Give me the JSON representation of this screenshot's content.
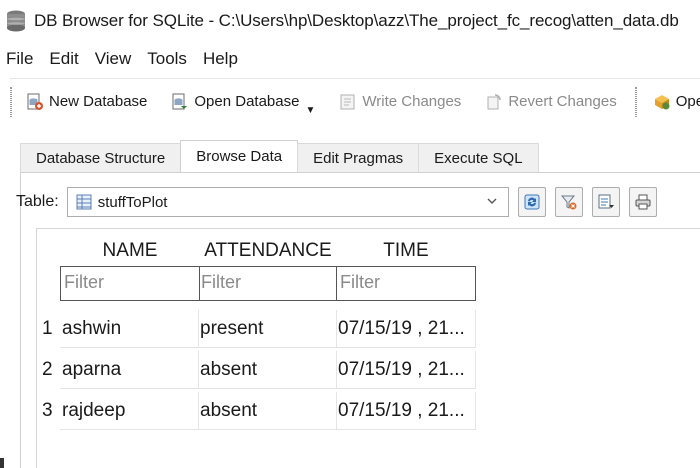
{
  "window": {
    "title": "DB Browser for SQLite - C:\\Users\\hp\\Desktop\\azz\\The_project_fc_recog\\atten_data.db"
  },
  "menu": [
    "File",
    "Edit",
    "View",
    "Tools",
    "Help"
  ],
  "toolbar": {
    "new_database": "New Database",
    "open_database": "Open Database",
    "write_changes": "Write Changes",
    "revert_changes": "Revert Changes",
    "open_project": "Ope"
  },
  "tabs": [
    "Database Structure",
    "Browse Data",
    "Edit Pragmas",
    "Execute SQL"
  ],
  "active_tab": "Browse Data",
  "table_selector": {
    "label": "Table:",
    "value": "stuffToPlot"
  },
  "grid": {
    "columns": [
      "NAME",
      "ATTENDANCE",
      "TIME"
    ],
    "filter_placeholder": "Filter",
    "rows": [
      {
        "num": "1",
        "cells": [
          "ashwin",
          "present",
          "07/15/19 , 21..."
        ]
      },
      {
        "num": "2",
        "cells": [
          "aparna",
          "absent",
          "07/15/19 , 21..."
        ]
      },
      {
        "num": "3",
        "cells": [
          "rajdeep",
          "absent",
          "07/15/19 , 21..."
        ]
      }
    ]
  },
  "icons": {
    "app": "database-icon",
    "new_db": "new-database-icon",
    "open_db": "open-database-icon",
    "write": "write-changes-icon",
    "revert": "revert-changes-icon",
    "open_project": "open-project-icon",
    "refresh": "refresh-icon",
    "clear_filters": "clear-filters-icon",
    "save_view": "save-view-icon",
    "print": "print-icon"
  }
}
